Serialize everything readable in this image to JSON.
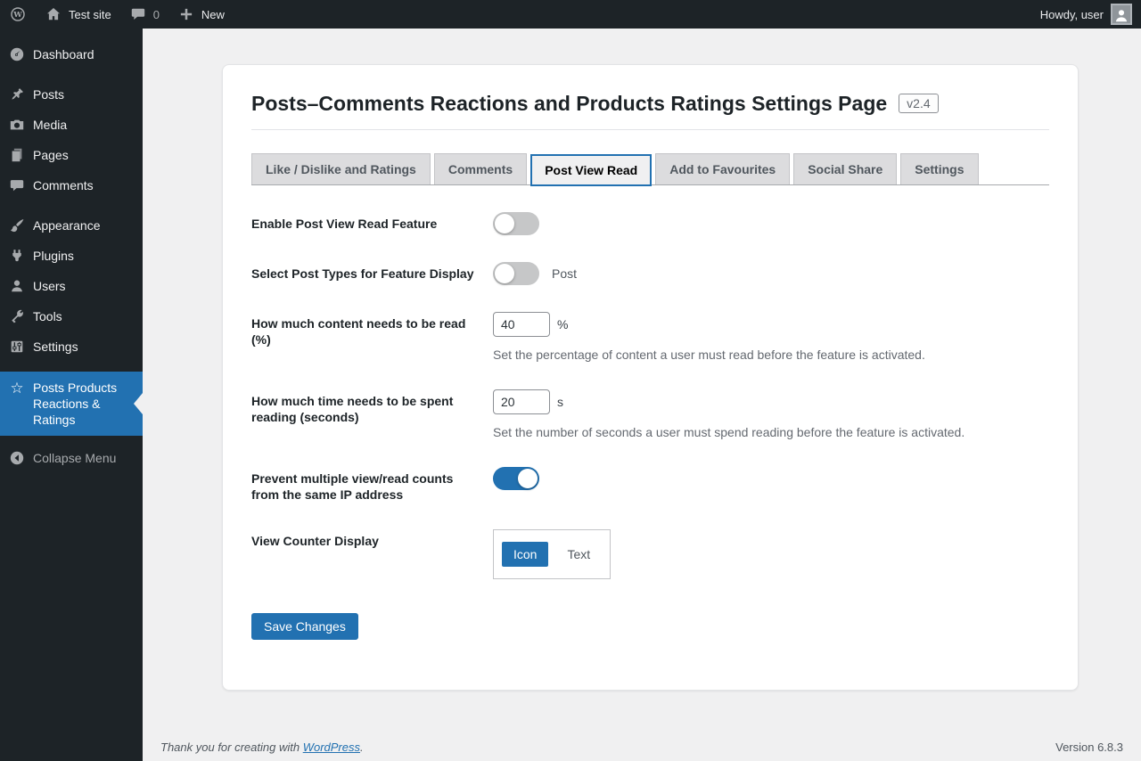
{
  "colors": {
    "accent": "#2271b1",
    "admin_dark": "#1d2327",
    "content_bg": "#f0f0f1"
  },
  "admin_bar": {
    "site_name": "Test site",
    "comment_count": "0",
    "new_label": "New",
    "howdy": "Howdy, user"
  },
  "sidebar": {
    "items": [
      {
        "label": "Dashboard",
        "icon": "dashboard-icon"
      },
      {
        "label": "Posts",
        "icon": "pushpin-icon"
      },
      {
        "label": "Media",
        "icon": "camera-icon"
      },
      {
        "label": "Pages",
        "icon": "pages-icon"
      },
      {
        "label": "Comments",
        "icon": "comment-icon"
      },
      {
        "label": "Appearance",
        "icon": "brush-icon"
      },
      {
        "label": "Plugins",
        "icon": "plug-icon"
      },
      {
        "label": "Users",
        "icon": "user-icon"
      },
      {
        "label": "Tools",
        "icon": "wrench-icon"
      },
      {
        "label": "Settings",
        "icon": "sliders-icon"
      }
    ],
    "current_item": {
      "label": "Posts Products Reactions & Ratings",
      "icon": "star-icon"
    },
    "collapse_label": "Collapse Menu"
  },
  "page": {
    "title": "Posts–Comments Reactions and Products Ratings Settings Page",
    "version_badge": "v2.4",
    "tabs": [
      {
        "label": "Like / Dislike and Ratings",
        "active": false
      },
      {
        "label": "Comments",
        "active": false
      },
      {
        "label": "Post View Read",
        "active": true
      },
      {
        "label": "Add to Favourites",
        "active": false
      },
      {
        "label": "Social Share",
        "active": false
      },
      {
        "label": "Settings",
        "active": false
      }
    ],
    "form": {
      "rows": [
        {
          "label": "Enable Post View Read Feature",
          "control": "toggle",
          "state": "off"
        },
        {
          "label": "Select Post Types for Feature Display",
          "control": "toggle",
          "state": "off",
          "suffix": "Post"
        },
        {
          "label": "How much content needs to be read (%)",
          "control": "number",
          "value": "40",
          "unit": "%",
          "description": "Set the percentage of content a user must read before the feature is activated."
        },
        {
          "label": "How much time needs to be spent reading (seconds)",
          "control": "number",
          "value": "20",
          "unit": "s",
          "description": "Set the number of seconds a user must spend reading before the feature is activated."
        },
        {
          "label": "Prevent multiple view/read counts from the same IP address",
          "control": "toggle",
          "state": "on"
        },
        {
          "label": "View Counter Display",
          "control": "segmented",
          "options": [
            "Icon",
            "Text"
          ],
          "selected": "Icon"
        }
      ]
    },
    "save_label": "Save Changes"
  },
  "footer": {
    "thanks_prefix": "Thank you for creating with ",
    "link_label": "WordPress",
    "thanks_suffix": ".",
    "version": "Version 6.8.3"
  }
}
